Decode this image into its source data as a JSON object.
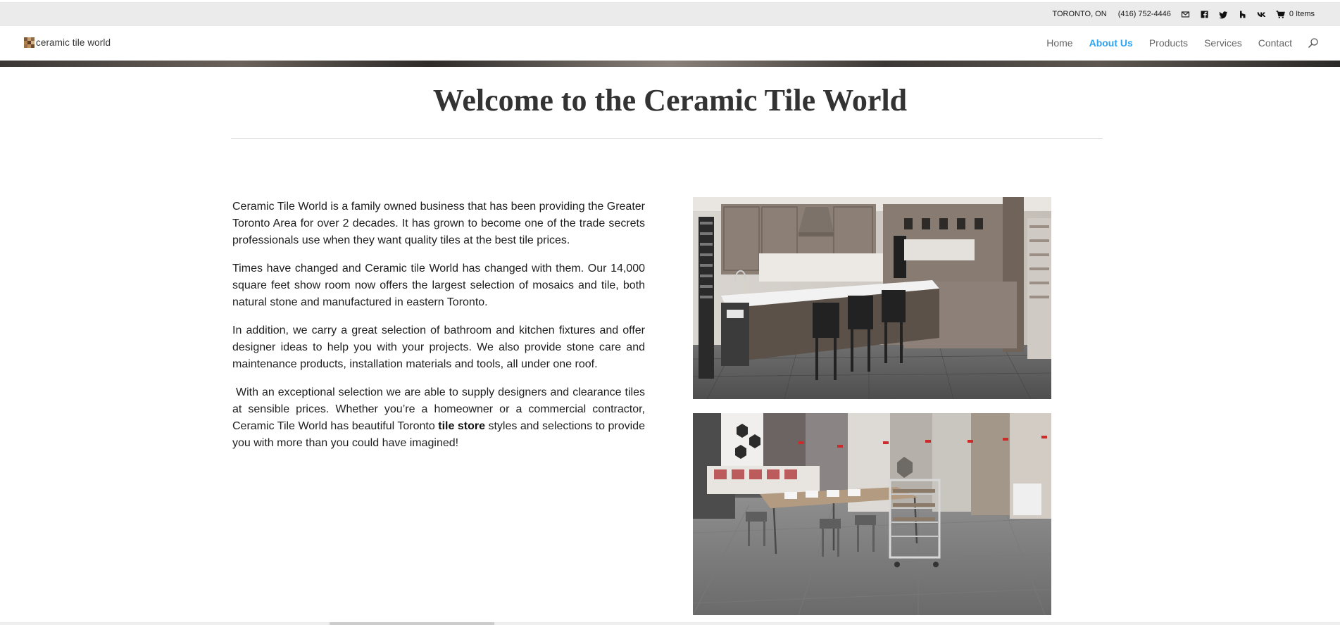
{
  "top_bar": {
    "location": "TORONTO, ON",
    "phone": "(416) 752-4446",
    "icons": [
      "email-icon",
      "facebook-icon",
      "twitter-icon",
      "houzz-icon",
      "vk-icon",
      "cart-icon"
    ],
    "cart_label": "0 Items"
  },
  "header": {
    "logo_text": "ceramic tile world",
    "nav": [
      {
        "label": "Home",
        "active": false
      },
      {
        "label": "About Us",
        "active": true
      },
      {
        "label": "Products",
        "active": false
      },
      {
        "label": "Services",
        "active": false
      },
      {
        "label": "Contact",
        "active": false
      }
    ],
    "accent_color": "#2ea3f2"
  },
  "main": {
    "title": "Welcome to the Ceramic Tile World",
    "paragraphs": [
      "Ceramic Tile World is a family owned business that has been providing the Greater Toronto Area for over 2 decades. It has grown to become one of the trade secrets professionals use when they want quality tiles at the best tile prices.",
      "Times have changed and Ceramic tile World has changed with them. Our 14,000 square feet show room now offers the largest selection of mosaics and tile, both natural stone and manufactured in eastern Toronto.",
      "In addition, we carry a great selection of bathroom and kitchen fixtures and offer designer ideas to help you with your projects. We also provide stone care and maintenance products, installation materials and tools, all under one roof."
    ],
    "last_paragraph": {
      "before": " With an exceptional selection we are able to supply designers and clearance tiles at sensible prices. Whether you’re a homeowner or a commercial contractor, Ceramic Tile World has beautiful Toronto ",
      "bold": "tile store",
      "after": " styles and selections to provide you with more than you could have imagined!"
    }
  }
}
